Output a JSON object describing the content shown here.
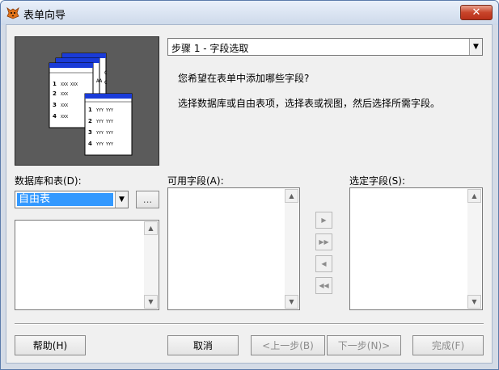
{
  "window": {
    "title": "表单向导",
    "close_glyph": "✕"
  },
  "step": {
    "selected": "步骤 1 - 字段选取",
    "question": "您希望在表单中添加哪些字段?",
    "instruction": "选择数据库或自由表项，选择表或视图，然后选择所需字段。"
  },
  "illustration": {
    "rows_back": [
      {
        "num": "1",
        "text": "XXX XXX"
      },
      {
        "num": "2",
        "text": "XXX"
      },
      {
        "num": "3",
        "text": "XXX"
      },
      {
        "num": "4",
        "text": "XXX"
      }
    ],
    "rows_front": [
      {
        "num": "1",
        "text": "YYY YYY"
      },
      {
        "num": "2",
        "text": "YYY YYY"
      },
      {
        "num": "3",
        "text": "YYY YYY"
      },
      {
        "num": "4",
        "text": "YYY YYY"
      }
    ],
    "tab_text": "AA"
  },
  "database": {
    "label": "数据库和表(D):",
    "selected": "自由表",
    "browse_label": "..."
  },
  "available_fields": {
    "label": "可用字段(A):"
  },
  "selected_fields": {
    "label": "选定字段(S):"
  },
  "move_buttons": {
    "add": "▶",
    "add_all": "▶▶",
    "remove": "◀",
    "remove_all": "◀◀"
  },
  "footer": {
    "help": "帮助(H)",
    "cancel": "取消",
    "back": "<上一步(B)",
    "next": "下一步(N)>",
    "finish": "完成(F)"
  },
  "scroll": {
    "up": "▲",
    "down": "▼"
  },
  "dropdown_glyph": "▼"
}
